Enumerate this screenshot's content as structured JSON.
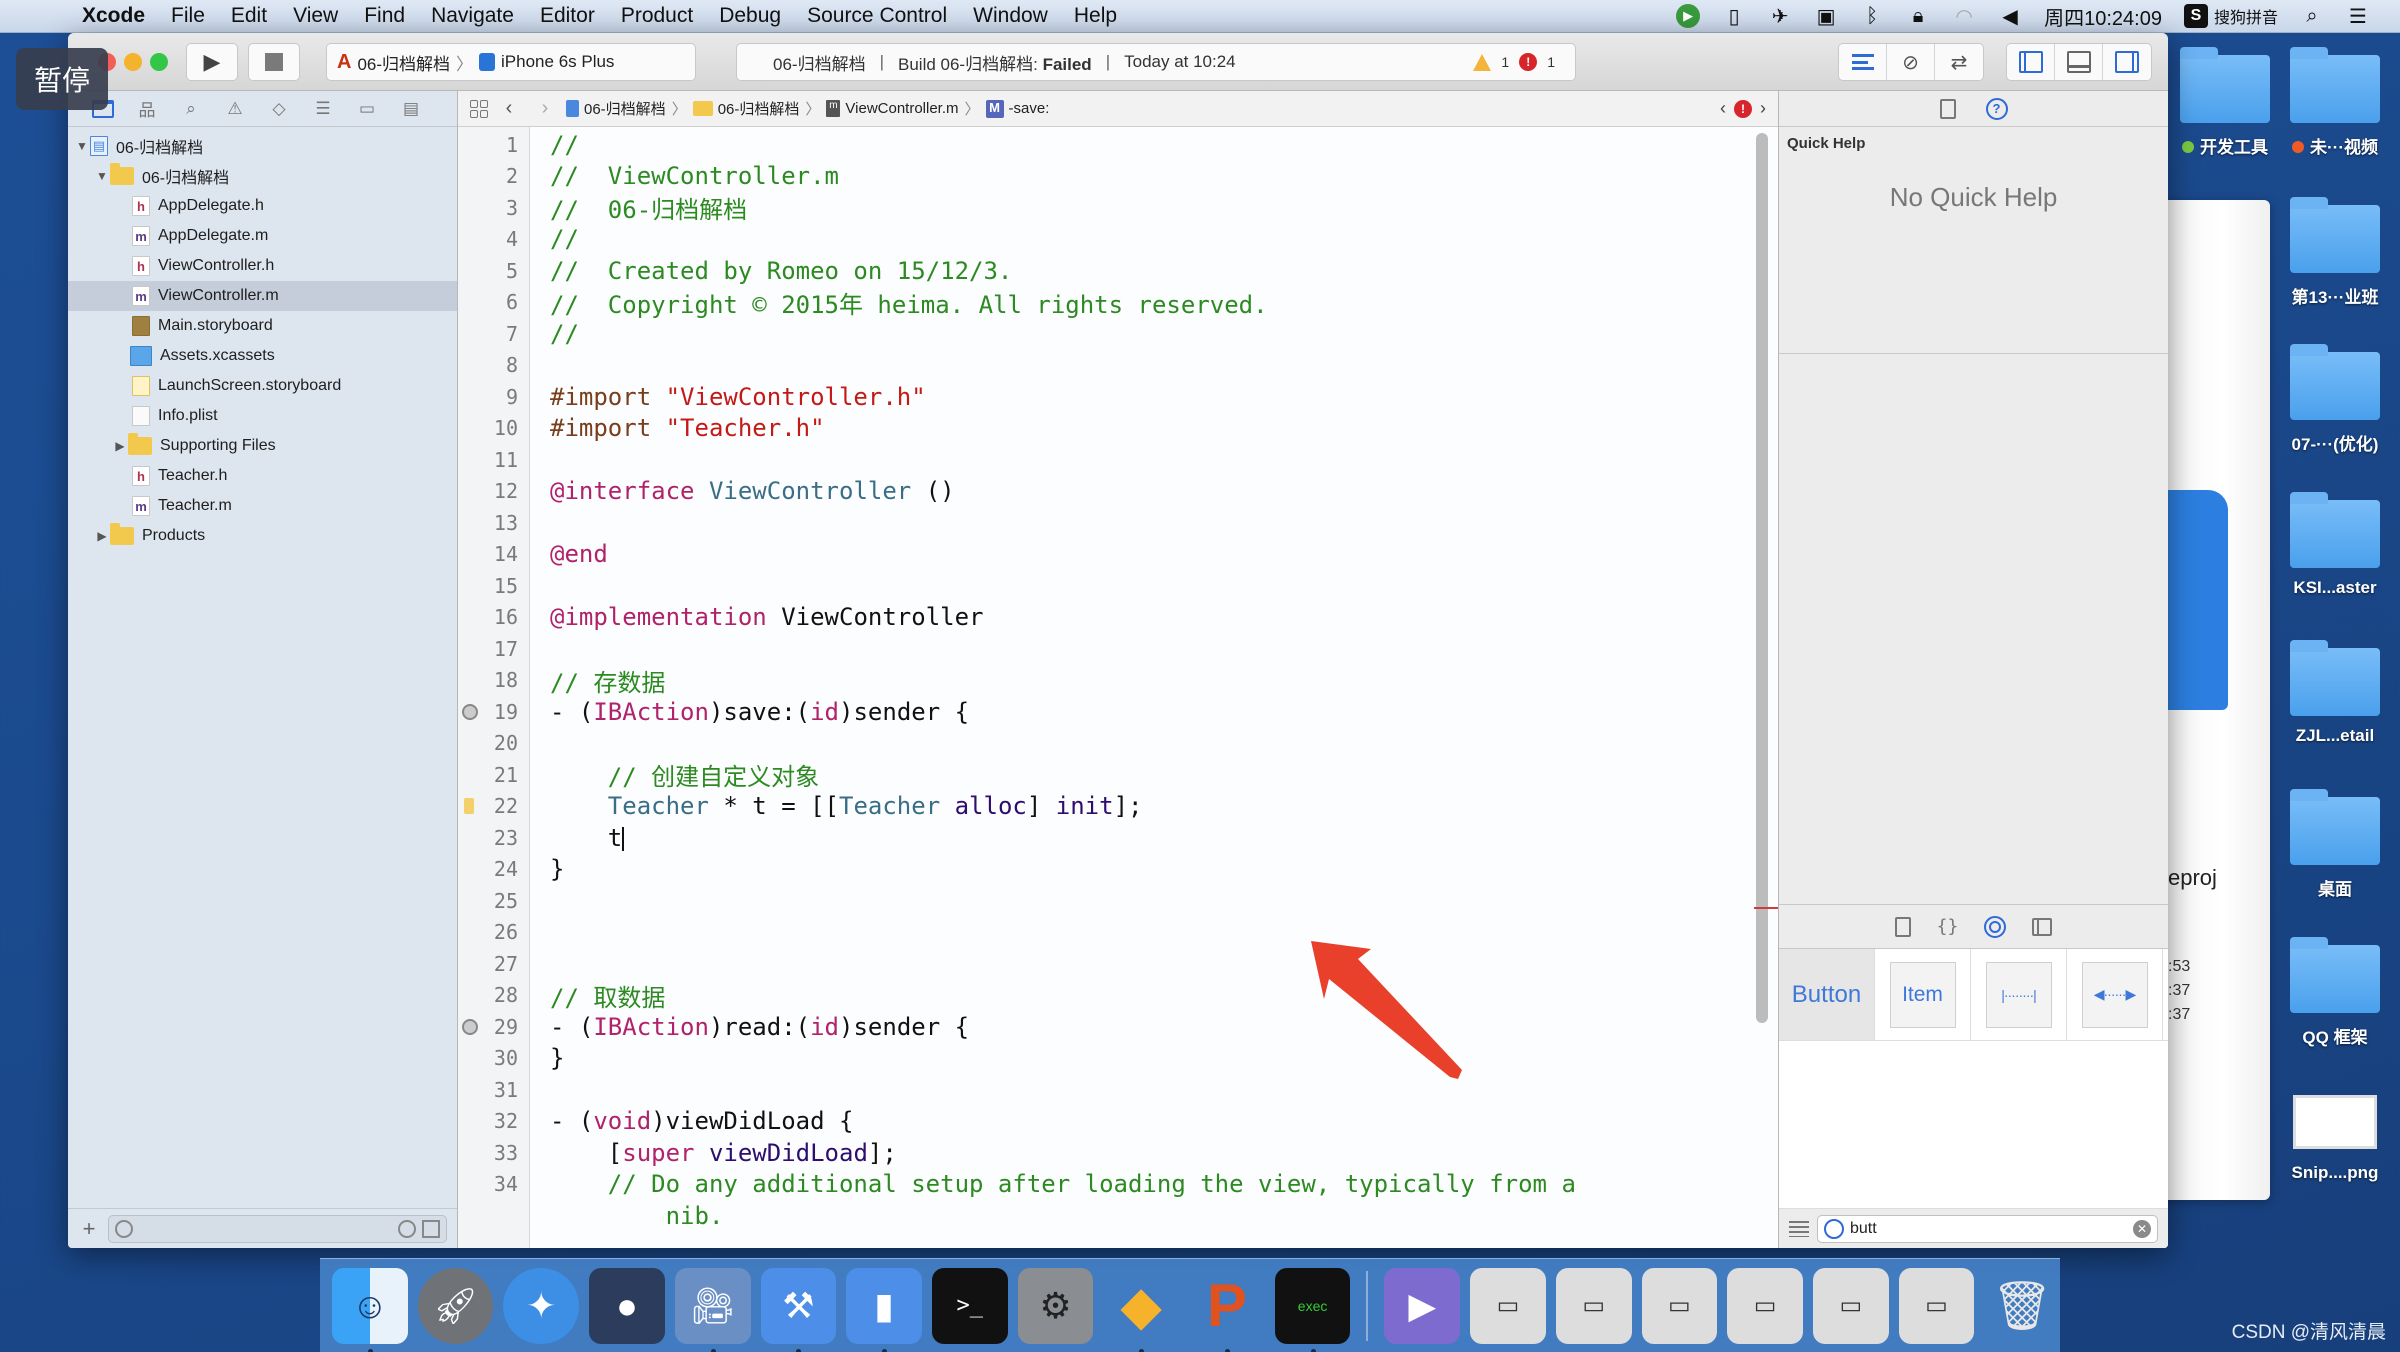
{
  "menubar": {
    "app": "Xcode",
    "menus": [
      "File",
      "Edit",
      "View",
      "Find",
      "Navigate",
      "Editor",
      "Product",
      "Debug",
      "Source Control",
      "Window",
      "Help"
    ],
    "clock": "周四10:24:09",
    "ime": "搜狗拼音",
    "ime_badge": "S"
  },
  "overlay": {
    "pause_label": "暂停"
  },
  "toolbar": {
    "scheme_name": "06-归档解档",
    "device": "iPhone 6s Plus",
    "activity_project": "06-归档解档",
    "activity_build": "Build 06-归档解档:",
    "activity_status": "Failed",
    "activity_time": "Today at 10:24",
    "warnings_count": "1",
    "errors_count": "1"
  },
  "navigator": {
    "tree": [
      {
        "label": "06-归档解档",
        "type": "project",
        "expanded": true
      },
      {
        "label": "06-归档解档",
        "type": "folder",
        "expanded": true
      },
      {
        "label": "AppDelegate.h",
        "type": "h"
      },
      {
        "label": "AppDelegate.m",
        "type": "m"
      },
      {
        "label": "ViewController.h",
        "type": "h"
      },
      {
        "label": "ViewController.m",
        "type": "m",
        "selected": true
      },
      {
        "label": "Main.storyboard",
        "type": "sb"
      },
      {
        "label": "Assets.xcassets",
        "type": "xca"
      },
      {
        "label": "LaunchScreen.storyboard",
        "type": "lsb"
      },
      {
        "label": "Info.plist",
        "type": "plist"
      },
      {
        "label": "Supporting Files",
        "type": "folder",
        "expanded": false
      },
      {
        "label": "Teacher.h",
        "type": "h"
      },
      {
        "label": "Teacher.m",
        "type": "m"
      },
      {
        "label": "Products",
        "type": "folder",
        "expanded": false
      }
    ],
    "filter_placeholder": ""
  },
  "jumpbar": {
    "crumbs": [
      "06-归档解档",
      "06-归档解档",
      "ViewController.m",
      "-save:"
    ]
  },
  "editor": {
    "lines": [
      {
        "n": "1",
        "html": "<span class='c-comment'>//</span>"
      },
      {
        "n": "2",
        "html": "<span class='c-comment'>//  ViewController.m</span>"
      },
      {
        "n": "3",
        "html": "<span class='c-comment'>//  06-归档解档</span>"
      },
      {
        "n": "4",
        "html": "<span class='c-comment'>//</span>"
      },
      {
        "n": "5",
        "html": "<span class='c-comment'>//  Created by Romeo on 15/12/3.</span>"
      },
      {
        "n": "6",
        "html": "<span class='c-comment'>//  Copyright © 2015年 heima. All rights reserved.</span>"
      },
      {
        "n": "7",
        "html": "<span class='c-comment'>//</span>"
      },
      {
        "n": "8",
        "html": ""
      },
      {
        "n": "9",
        "html": "<span class='c-pp'>#import </span><span class='c-str'>\"ViewController.h\"</span>"
      },
      {
        "n": "10",
        "html": "<span class='c-pp'>#import </span><span class='c-str'>\"Teacher.h\"</span>"
      },
      {
        "n": "11",
        "html": ""
      },
      {
        "n": "12",
        "html": "<span class='c-key'>@interface</span> <span class='c-cls'>ViewController</span> ()"
      },
      {
        "n": "13",
        "html": ""
      },
      {
        "n": "14",
        "html": "<span class='c-key'>@end</span>"
      },
      {
        "n": "15",
        "html": ""
      },
      {
        "n": "16",
        "html": "<span class='c-key'>@implementation</span> ViewController"
      },
      {
        "n": "17",
        "html": ""
      },
      {
        "n": "18",
        "html": "<span class='c-comment'>// 存数据</span>"
      },
      {
        "n": "19",
        "html": "- (<span class='c-key'>IBAction</span>)save:(<span class='c-key'>id</span>)sender {",
        "marker": "breakpoint"
      },
      {
        "n": "20",
        "html": ""
      },
      {
        "n": "21",
        "html": "    <span class='c-comment'>// 创建自定义对象</span>"
      },
      {
        "n": "22",
        "html": "    <span class='c-cls'>Teacher</span> * t = [[<span class='c-cls'>Teacher</span> <span class='c-builtin'>alloc</span>] <span class='c-builtin'>init</span>];",
        "marker": "warning"
      },
      {
        "n": "23",
        "html": "    t<span class='caret'></span>"
      },
      {
        "n": "24",
        "html": "}"
      },
      {
        "n": "25",
        "html": ""
      },
      {
        "n": "26",
        "html": ""
      },
      {
        "n": "27",
        "html": ""
      },
      {
        "n": "28",
        "html": "<span class='c-comment'>// 取数据</span>"
      },
      {
        "n": "29",
        "html": "- (<span class='c-key'>IBAction</span>)read:(<span class='c-key'>id</span>)sender {",
        "marker": "breakpoint"
      },
      {
        "n": "30",
        "html": "}"
      },
      {
        "n": "31",
        "html": ""
      },
      {
        "n": "32",
        "html": "- (<span class='c-key'>void</span>)viewDidLoad {"
      },
      {
        "n": "33",
        "html": "    [<span class='c-key'>super</span> <span class='c-builtin'>viewDidLoad</span>];"
      },
      {
        "n": "34",
        "html": "    <span class='c-comment'>// Do any additional setup after loading the view, typically from a</span>"
      },
      {
        "n": "",
        "html": "        <span class='c-comment'>nib.</span>"
      }
    ]
  },
  "inspector": {
    "quick_help_title": "Quick Help",
    "quick_help_empty": "No Quick Help",
    "library_items": [
      "Button",
      "Item",
      "flexible-space",
      "fixed-space"
    ],
    "library_filter_value": "butt"
  },
  "background_window": {
    "fragment_text": "eproj",
    "times": [
      ":53",
      ":37",
      ":37"
    ]
  },
  "desktop": {
    "icons": [
      {
        "label": "开发工具",
        "tag_color": "#7ac943"
      },
      {
        "label": "未···视频",
        "tag_color": "#f15a24"
      },
      {
        "label": "第13···业班"
      },
      {
        "label": "07-···(优化)"
      },
      {
        "label": "KSI...aster"
      },
      {
        "label": "ZJL...etail"
      },
      {
        "label": "桌面"
      },
      {
        "label": "QQ 框架"
      },
      {
        "label": "Snip....png"
      }
    ]
  },
  "dock": {
    "apps": [
      "Finder",
      "Launchpad",
      "Safari",
      "Mouse",
      "Video Editor",
      "Xcode",
      "Simulator",
      "Terminal",
      "System Preferences",
      "Sketch",
      "Pages",
      "Console"
    ],
    "windows": [
      "QuickTime",
      "window-1",
      "window-2",
      "window-3",
      "window-4",
      "window-5",
      "window-6",
      "Trash"
    ]
  },
  "watermark": "CSDN @清风清晨"
}
